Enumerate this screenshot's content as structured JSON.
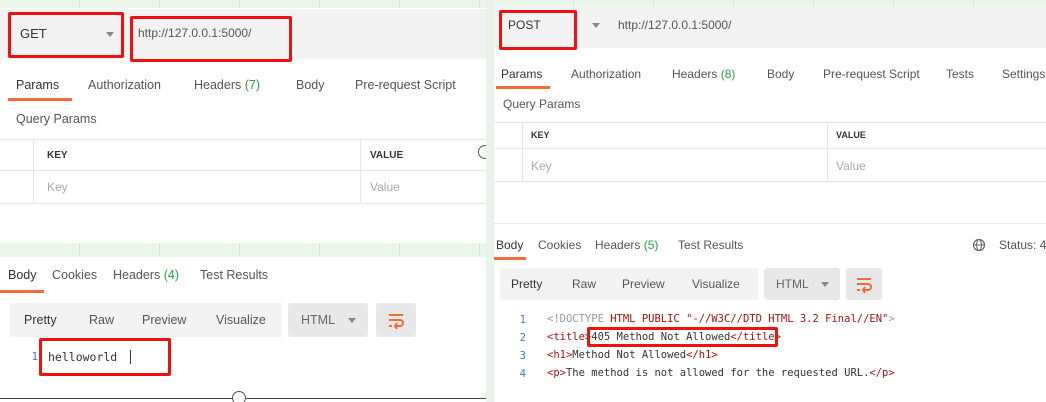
{
  "left": {
    "method": "GET",
    "url": "http://127.0.0.1:5000/",
    "request_tabs": [
      "Params",
      "Authorization",
      "Headers",
      "Body",
      "Pre-request Script"
    ],
    "headers_count": "(7)",
    "section_title": "Query Params",
    "table": {
      "key_header": "KEY",
      "value_header": "VALUE",
      "key_placeholder": "Key",
      "value_placeholder": "Value"
    },
    "response_tabs": [
      "Body",
      "Cookies",
      "Headers",
      "Test Results"
    ],
    "response_headers_count": "(4)",
    "toolbar": [
      "Pretty",
      "Raw",
      "Preview",
      "Visualize"
    ],
    "format": "HTML",
    "code_lines": [
      {
        "n": "1",
        "text": "helloworld"
      }
    ]
  },
  "right": {
    "method": "POST",
    "url": "http://127.0.0.1:5000/",
    "request_tabs": [
      "Params",
      "Authorization",
      "Headers",
      "Body",
      "Pre-request Script",
      "Tests",
      "Settings"
    ],
    "headers_count": "(8)",
    "section_title": "Query Params",
    "table": {
      "key_header": "KEY",
      "value_header": "VALUE",
      "key_placeholder": "Key",
      "value_placeholder": "Value"
    },
    "response_tabs": [
      "Body",
      "Cookies",
      "Headers",
      "Test Results"
    ],
    "response_headers_count": "(5)",
    "status_label": "Status: 4",
    "toolbar": [
      "Pretty",
      "Raw",
      "Preview",
      "Visualize"
    ],
    "format": "HTML",
    "code_line_numbers": [
      "1",
      "2",
      "3",
      "4"
    ],
    "code": {
      "l1_a": "<!DOCTYPE ",
      "l1_b": "HTML PUBLIC ",
      "l1_c": "\"-//W3C//DTD HTML 3.2 Final//EN\"",
      "l1_d": ">",
      "l2_open": "<title>",
      "l2_text": "405 Method Not Allowed",
      "l2_close": "</title>",
      "l3_open": "<h1>",
      "l3_text": "Method Not Allowed",
      "l3_close": "</h1>",
      "l4_open": "<p>",
      "l4_text": "The method is not allowed for the requested URL.",
      "l4_close": "</p>"
    }
  },
  "colors": {
    "accent": "#f26b3a",
    "count_green": "#28a04a",
    "highlight_red": "#e11111",
    "background_green": "#e9f3ea"
  }
}
